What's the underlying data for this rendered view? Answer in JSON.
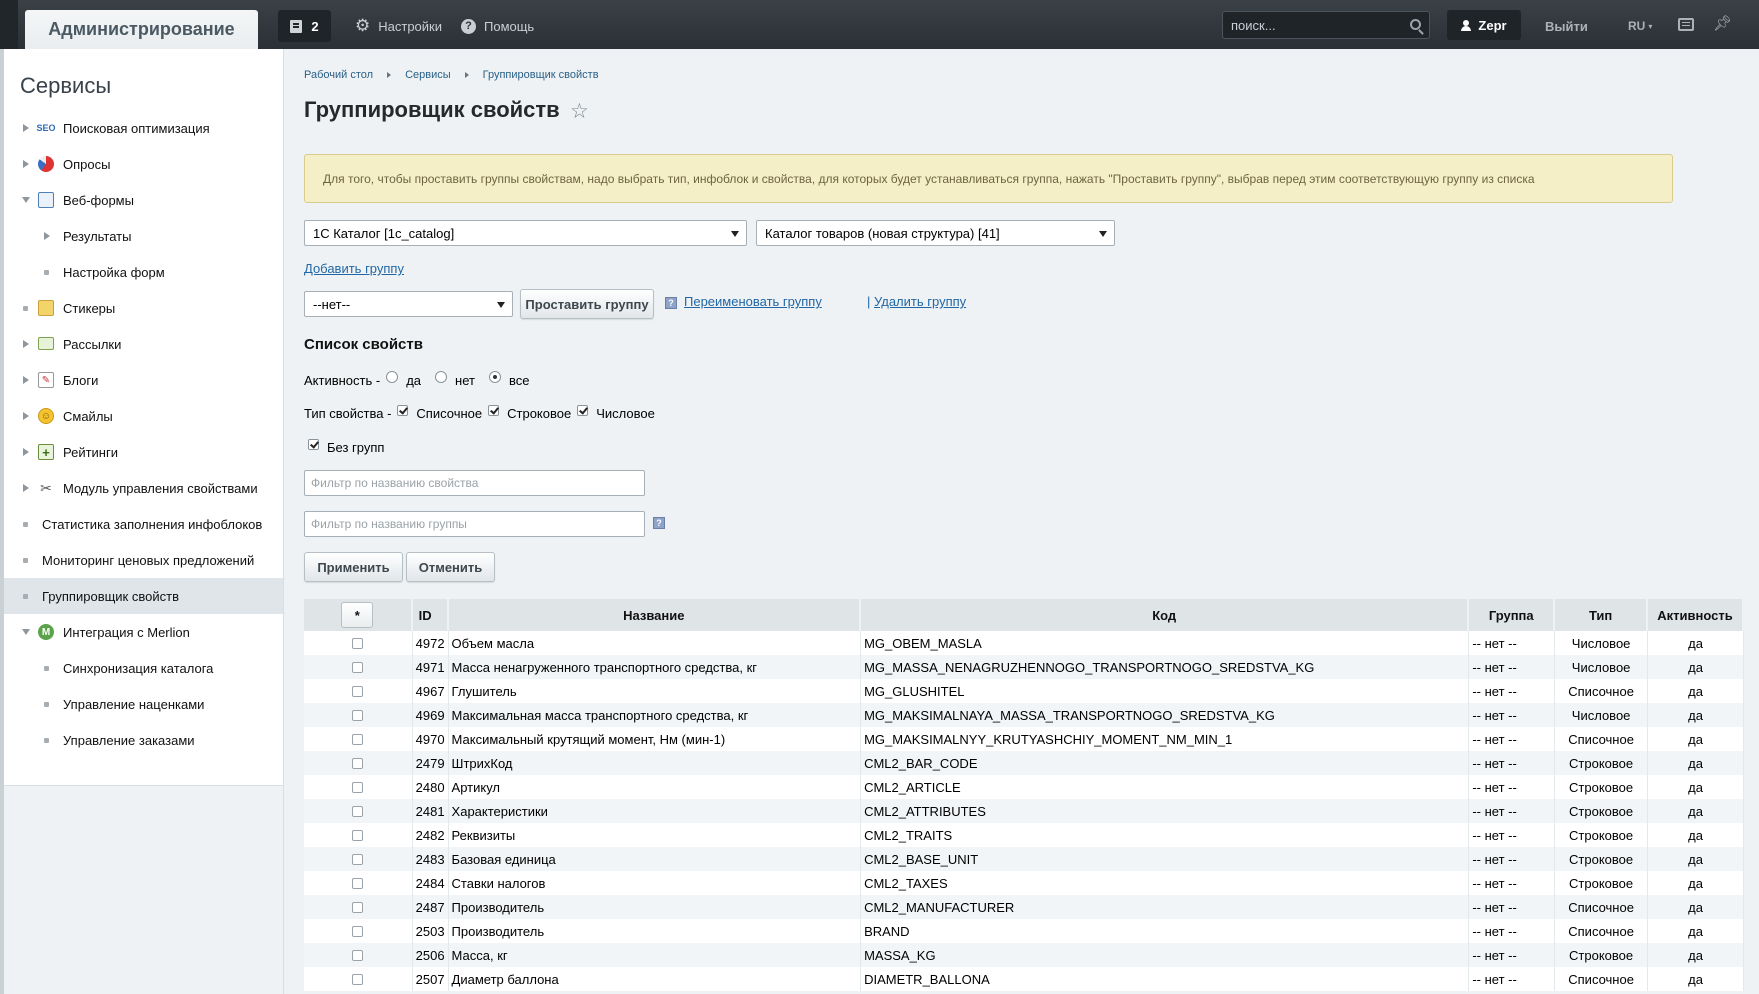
{
  "topbar": {
    "admin_tab": "Администрирование",
    "notifications_count": "2",
    "settings": "Настройки",
    "help": "Помощь",
    "search_placeholder": "поиск...",
    "user": "Zepr",
    "logout": "Выйти",
    "lang": "RU"
  },
  "sidebar": {
    "title": "Сервисы",
    "items": [
      {
        "label": "Поисковая оптимизация",
        "icon": "seo-icon"
      },
      {
        "label": "Опросы",
        "icon": "vote-icon"
      },
      {
        "label": "Веб-формы",
        "icon": "form-icon"
      },
      {
        "label": "Результаты"
      },
      {
        "label": "Настройка форм"
      },
      {
        "label": "Стикеры",
        "icon": "sticker-icon"
      },
      {
        "label": "Рассылки",
        "icon": "mail-icon"
      },
      {
        "label": "Блоги",
        "icon": "blog-icon"
      },
      {
        "label": "Смайлы",
        "icon": "smile-icon"
      },
      {
        "label": "Рейтинги",
        "icon": "rating-icon"
      },
      {
        "label": "Модуль управления свойствами",
        "icon": "tools-icon"
      },
      {
        "label": "Статистика заполнения инфоблоков"
      },
      {
        "label": "Мониторинг ценовых предложений"
      },
      {
        "label": "Группировщик свойств"
      },
      {
        "label": "Интеграция с Merlion",
        "icon": "merlion-icon"
      },
      {
        "label": "Синхронизация каталога"
      },
      {
        "label": "Управление наценками"
      },
      {
        "label": "Управление заказами"
      }
    ]
  },
  "breadcrumb": [
    "Рабочий стол",
    "Сервисы",
    "Группировщик свойств"
  ],
  "page_title": "Группировщик свойств",
  "notice": "Для того, чтобы проставить группы свойствам, надо выбрать тип, инфоблок и свойства, для которых будет устанавливаться группа, нажать \"Проставить группу\", выбрав перед этим соответствующую группу из списка",
  "form": {
    "iblock_type": "1С Каталог [1c_catalog]",
    "iblock": "Каталог товаров (новая структура) [41]",
    "add_group": "Добавить группу",
    "group_select": "--нет--",
    "set_group": "Проставить группу",
    "rename_group": "Переименовать группу",
    "link_sep": "|",
    "delete_group": "Удалить группу",
    "help_mark": "?"
  },
  "list": {
    "title": "Список свойств",
    "activity_label": "Активность -",
    "activity_yes": "да",
    "activity_no": "нет",
    "activity_all": "все",
    "type_label": "Тип свойства -",
    "type_list": "Списочное",
    "type_string": "Строковое",
    "type_number": "Числовое",
    "no_groups": "Без групп",
    "filter_name_placeholder": "Фильтр по названию свойства",
    "filter_group_placeholder": "Фильтр по названию группы",
    "apply": "Применить",
    "cancel": "Отменить"
  },
  "table": {
    "select_all": "*",
    "columns": [
      "ID",
      "Название",
      "Код",
      "Группа",
      "Тип",
      "Активность"
    ],
    "rows": [
      [
        "4972",
        "Объем масла",
        "MG_OBEM_MASLA",
        "-- нет --",
        "Числовое",
        "да"
      ],
      [
        "4971",
        "Масса ненагруженного транспортного средства, кг",
        "MG_MASSA_NENAGRUZHENNOGO_TRANSPORTNOGO_SREDSTVA_KG",
        "-- нет --",
        "Числовое",
        "да"
      ],
      [
        "4967",
        "Глушитель",
        "MG_GLUSHITEL",
        "-- нет --",
        "Списочное",
        "да"
      ],
      [
        "4969",
        "Максимальная масса транспортного средства, кг",
        "MG_MAKSIMALNAYA_MASSA_TRANSPORTNOGO_SREDSTVA_KG",
        "-- нет --",
        "Числовое",
        "да"
      ],
      [
        "4970",
        "Максимальный крутящий момент, Нм (мин-1)",
        "MG_MAKSIMALNYY_KRUTYASHCHIY_MOMENT_NM_MIN_1",
        "-- нет --",
        "Списочное",
        "да"
      ],
      [
        "2479",
        "ШтрихКод",
        "CML2_BAR_CODE",
        "-- нет --",
        "Строковое",
        "да"
      ],
      [
        "2480",
        "Артикул",
        "CML2_ARTICLE",
        "-- нет --",
        "Строковое",
        "да"
      ],
      [
        "2481",
        "Характеристики",
        "CML2_ATTRIBUTES",
        "-- нет --",
        "Строковое",
        "да"
      ],
      [
        "2482",
        "Реквизиты",
        "CML2_TRAITS",
        "-- нет --",
        "Строковое",
        "да"
      ],
      [
        "2483",
        "Базовая единица",
        "CML2_BASE_UNIT",
        "-- нет --",
        "Строковое",
        "да"
      ],
      [
        "2484",
        "Ставки налогов",
        "CML2_TAXES",
        "-- нет --",
        "Строковое",
        "да"
      ],
      [
        "2487",
        "Производитель",
        "CML2_MANUFACTURER",
        "-- нет --",
        "Списочное",
        "да"
      ],
      [
        "2503",
        "Производитель",
        "BRAND",
        "-- нет --",
        "Списочное",
        "да"
      ],
      [
        "2506",
        "Масса, кг",
        "MASSA_KG",
        "-- нет --",
        "Строковое",
        "да"
      ],
      [
        "2507",
        "Диаметр баллона",
        "DIAMETR_BALLONA",
        "-- нет --",
        "Списочное",
        "да"
      ]
    ]
  }
}
